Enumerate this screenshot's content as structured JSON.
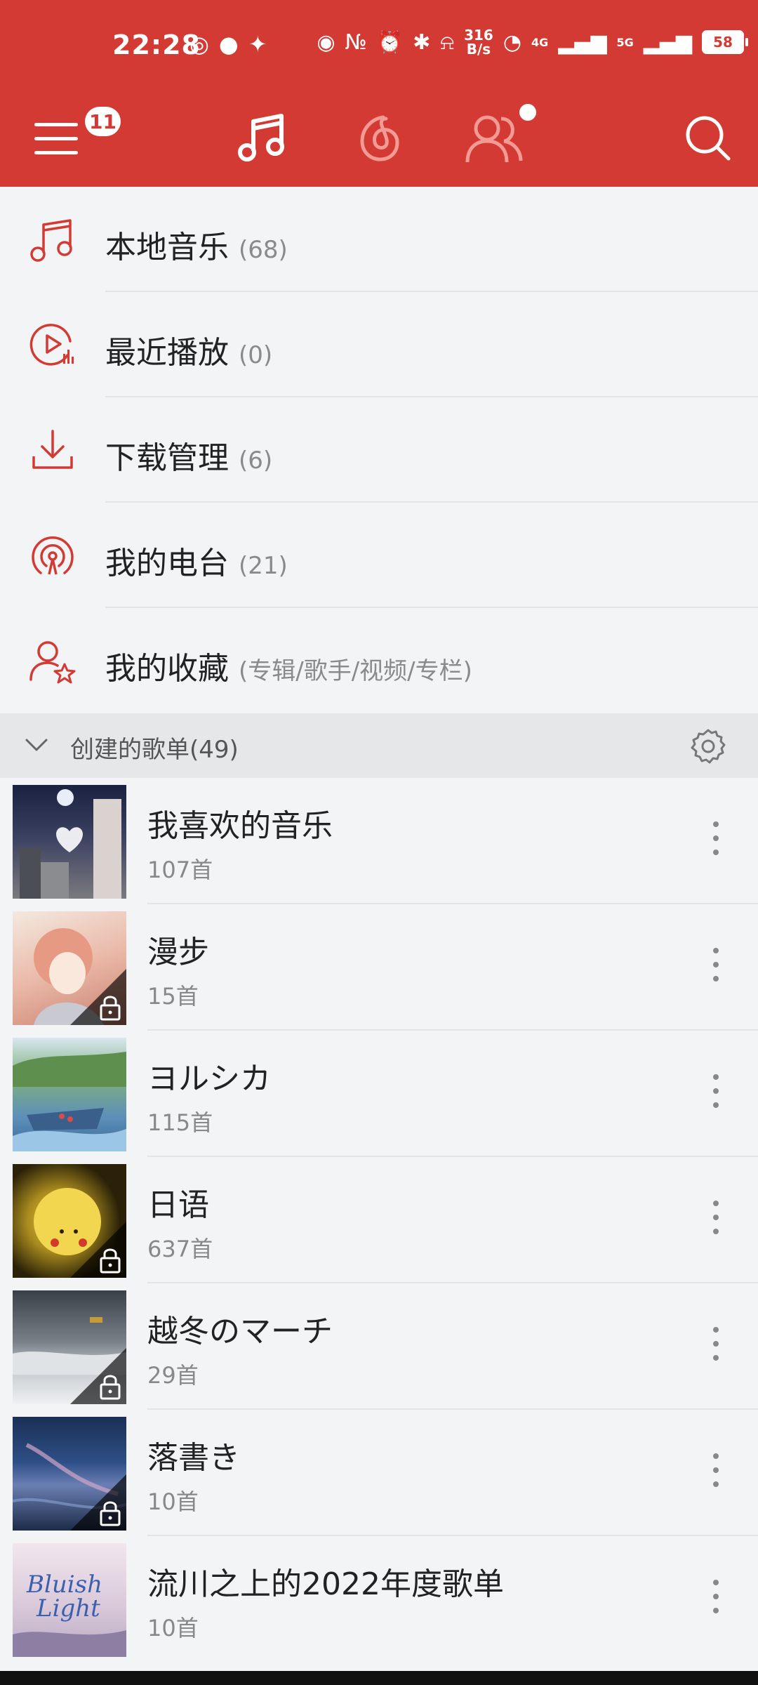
{
  "colors": {
    "accent": "#d33a33",
    "background": "#f3f4f6"
  },
  "status_bar": {
    "time": "22:28",
    "speed_top": "316",
    "speed_bottom": "B/s",
    "net1": "4G",
    "net2": "5G",
    "battery": "58"
  },
  "toolbar": {
    "menu_badge": "11"
  },
  "menu": [
    {
      "label": "本地音乐",
      "count": "(68)",
      "icon": "music-note-icon"
    },
    {
      "label": "最近播放",
      "count": "(0)",
      "icon": "recent-play-icon"
    },
    {
      "label": "下载管理",
      "count": "(6)",
      "icon": "download-icon"
    },
    {
      "label": "我的电台",
      "count": "(21)",
      "icon": "radio-icon"
    },
    {
      "label": "我的收藏",
      "count": "(专辑/歌手/视频/专栏)",
      "icon": "favorite-user-icon"
    }
  ],
  "section": {
    "title": "创建的歌单(49)"
  },
  "playlists": [
    {
      "name": "我喜欢的音乐",
      "count": "107首",
      "locked": false,
      "cover_color": "#2b2e3a"
    },
    {
      "name": "漫步",
      "count": "15首",
      "locked": true,
      "cover_color": "#e8b3a6"
    },
    {
      "name": "ヨルシカ",
      "count": "115首",
      "locked": false,
      "cover_color": "#5d8fb9"
    },
    {
      "name": "日语",
      "count": "637首",
      "locked": true,
      "cover_color": "#3a2e10"
    },
    {
      "name": "越冬のマーチ",
      "count": "29首",
      "locked": true,
      "cover_color": "#6e7780"
    },
    {
      "name": "落書き",
      "count": "10首",
      "locked": true,
      "cover_color": "#1f3c6b"
    },
    {
      "name": "流川之上的2022年度歌单",
      "count": "10首",
      "locked": false,
      "cover_color": "#d9c9d9"
    }
  ]
}
